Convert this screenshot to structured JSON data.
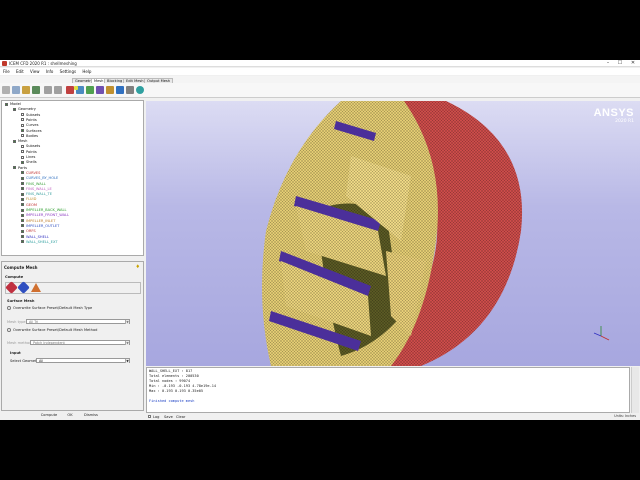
{
  "window": {
    "title": "ICEM CFD 2020 R1 : shellmeshing",
    "min": "–",
    "max": "☐",
    "close": "✕"
  },
  "menu": [
    "File",
    "Edit",
    "View",
    "Info",
    "Settings",
    "Help"
  ],
  "tabs": [
    "Geometry",
    "Mesh",
    "Blocking",
    "Edit Mesh",
    "Output Mesh"
  ],
  "active_tab": "Mesh",
  "tree": [
    {
      "label": "Model",
      "level": 0,
      "checked": true
    },
    {
      "label": "Geometry",
      "level": 1,
      "checked": true
    },
    {
      "label": "Subsets",
      "level": 2,
      "checked": false
    },
    {
      "label": "Points",
      "level": 2,
      "checked": false
    },
    {
      "label": "Curves",
      "level": 2,
      "checked": false
    },
    {
      "label": "Surfaces",
      "level": 2,
      "checked": true
    },
    {
      "label": "Bodies",
      "level": 2,
      "checked": false
    },
    {
      "label": "Mesh",
      "level": 1,
      "checked": true
    },
    {
      "label": "Subsets",
      "level": 2,
      "checked": false
    },
    {
      "label": "Points",
      "level": 2,
      "checked": false
    },
    {
      "label": "Lines",
      "level": 2,
      "checked": false
    },
    {
      "label": "Shells",
      "level": 2,
      "checked": true
    },
    {
      "label": "Parts",
      "level": 1,
      "checked": true
    },
    {
      "label": "CURVES",
      "level": 2,
      "checked": true,
      "color": "#c03030"
    },
    {
      "label": "CURVES_BY_HOLE",
      "level": 2,
      "checked": true,
      "color": "#3070c0"
    },
    {
      "label": "FINS_WALL",
      "level": 2,
      "checked": true,
      "color": "#3aa03a"
    },
    {
      "label": "FINS_WALL_LE",
      "level": 2,
      "checked": true,
      "color": "#c060c0"
    },
    {
      "label": "FINS_WALL_TE",
      "level": 2,
      "checked": true,
      "color": "#3aa0a0"
    },
    {
      "label": "FLUID",
      "level": 2,
      "checked": true,
      "color": "#c09030"
    },
    {
      "label": "GEOM",
      "level": 2,
      "checked": true,
      "color": "#c03030"
    },
    {
      "label": "IMPELLER_BACK_WALL",
      "level": 2,
      "checked": true,
      "color": "#30a030"
    },
    {
      "label": "IMPELLER_FRONT_WALL",
      "level": 2,
      "checked": true,
      "color": "#8a3ac0"
    },
    {
      "label": "IMPELLER_INLET",
      "level": 2,
      "checked": true,
      "color": "#c08030"
    },
    {
      "label": "IMPELLER_OUTLET",
      "level": 2,
      "checked": true,
      "color": "#3050c0"
    },
    {
      "label": "ORFS",
      "level": 2,
      "checked": true,
      "color": "#c03030"
    },
    {
      "label": "WALL_SHELL",
      "level": 2,
      "checked": true,
      "color": "#3030c0"
    },
    {
      "label": "WALL_SHELL_EXT",
      "level": 2,
      "checked": true,
      "color": "#30a0a0"
    }
  ],
  "panel": {
    "title": "Compute Mesh",
    "group": "Compute",
    "section": "Surface Mesh",
    "opt1": "Overwrite Surface Preset/Default Mesh Type",
    "mesh_type_label": "Mesh type",
    "mesh_type_value": "All Tri",
    "opt2": "Overwrite Surface Preset/Default Mesh Method",
    "mesh_method_label": "Mesh method",
    "mesh_method_value": "Patch Independent",
    "input_section": "Input",
    "select_geometry_label": "Select Geometry",
    "select_geometry_value": "All"
  },
  "buttons": {
    "compute": "Compute",
    "ok": "OK",
    "dismiss": "Dismiss"
  },
  "logo": {
    "brand": "ANSYS",
    "version": "2020 R1"
  },
  "messages": [
    {
      "text": "    WALL_SHELL_EXT      : 817",
      "blue": false
    },
    {
      "text": "Total elements : 200530",
      "blue": false
    },
    {
      "text": "Total nodes : 99074",
      "blue": false
    },
    {
      "text": "Min : -0.193 -0.193 4.78e19e-14",
      "blue": false
    },
    {
      "text": "Max :  0.193 0.193 0.35e05",
      "blue": false
    },
    {
      "text": "",
      "blue": false
    },
    {
      "text": "Finished compute mesh",
      "blue": true
    }
  ],
  "logbar": {
    "log": "Log",
    "save": "Save",
    "clear": "Clear"
  },
  "status": "Units: Inches"
}
